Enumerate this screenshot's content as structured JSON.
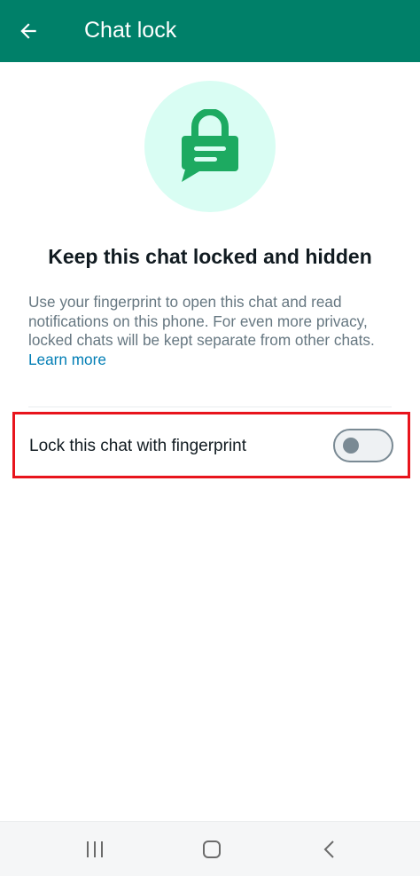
{
  "header": {
    "title": "Chat lock",
    "back_icon": "arrow-left-icon",
    "background": "#008069"
  },
  "hero": {
    "icon": "chat-lock-icon",
    "circle_color": "#d9fdf3",
    "icon_color": "#1daa61"
  },
  "headline": "Keep this chat locked and hidden",
  "description": {
    "text": "Use your fingerprint to open this chat and read notifications on this phone. For even more privacy, locked chats will be kept separate from other chats.",
    "link": "Learn more"
  },
  "lock_setting": {
    "label": "Lock this chat with fingerprint",
    "enabled": false
  },
  "system_nav": {
    "recents_icon": "recents-icon",
    "home_icon": "home-icon",
    "back_icon": "nav-back-icon"
  }
}
